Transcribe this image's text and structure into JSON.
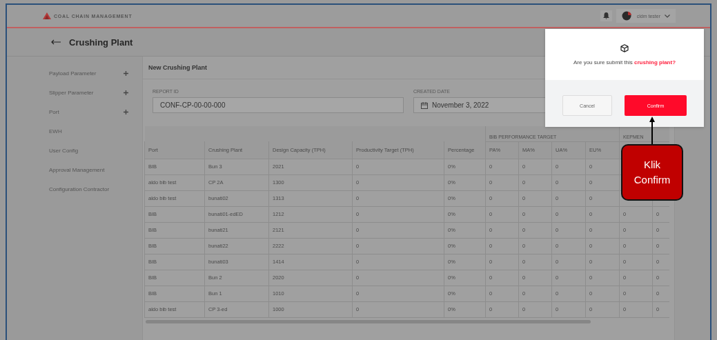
{
  "header": {
    "logo_text": "COAL CHAIN MANAGEMENT",
    "user": {
      "name": "cldm tester"
    }
  },
  "page": {
    "title": "Crushing Plant"
  },
  "sidebar": {
    "items": [
      {
        "label": "Payload Parameter",
        "expandable": true
      },
      {
        "label": "Slipper Parameter",
        "expandable": true
      },
      {
        "label": "Port",
        "expandable": true
      },
      {
        "label": "EWH",
        "expandable": false
      },
      {
        "label": "User Config",
        "expandable": false
      },
      {
        "label": "Approval Management",
        "expandable": false
      },
      {
        "label": "Configuration Contractor",
        "expandable": false
      }
    ]
  },
  "form": {
    "title": "New Crushing Plant",
    "report_id": {
      "label": "REPORT ID",
      "value": "CONF-CP-00-00-000"
    },
    "created_date": {
      "label": "CREATED DATE",
      "value": "November 3, 2022"
    }
  },
  "table": {
    "groups": [
      {
        "label": "BIB PERFORMANCE TARGET"
      },
      {
        "label": "KEPMEN"
      }
    ],
    "columns": [
      "Port",
      "Crushing Plant",
      "Design Capacity (TPH)",
      "Productivity Target (TPH)",
      "Percentage",
      "PA%",
      "MA%",
      "UA%",
      "EU%"
    ],
    "rows": [
      [
        "BIB",
        "Bun 3",
        "2021",
        "0",
        "0%",
        "0",
        "0",
        "0",
        "0"
      ],
      [
        "aldo bib test",
        "CP 2A",
        "1300",
        "0",
        "0%",
        "0",
        "0",
        "0",
        "0"
      ],
      [
        "aldo bib test",
        "bunati02",
        "1313",
        "0",
        "0%",
        "0",
        "0",
        "0",
        "0"
      ],
      [
        "BIB",
        "bunati01-edED",
        "1212",
        "0",
        "0%",
        "0",
        "0",
        "0",
        "0",
        "0",
        "0"
      ],
      [
        "BIB",
        "bunati21",
        "2121",
        "0",
        "0%",
        "0",
        "0",
        "0",
        "0",
        "0",
        "0"
      ],
      [
        "BIB",
        "bunati22",
        "2222",
        "0",
        "0%",
        "0",
        "0",
        "0",
        "0",
        "0",
        "0"
      ],
      [
        "BIB",
        "bunati03",
        "1414",
        "0",
        "0%",
        "0",
        "0",
        "0",
        "0",
        "0",
        "0"
      ],
      [
        "BIB",
        "Bun 2",
        "2020",
        "0",
        "0%",
        "0",
        "0",
        "0",
        "0",
        "0",
        "0"
      ],
      [
        "BIB",
        "Bun 1",
        "1010",
        "0",
        "0%",
        "0",
        "0",
        "0",
        "0",
        "0",
        "0"
      ],
      [
        "aldo bib test",
        "CP 3-ed",
        "1000",
        "0",
        "0%",
        "0",
        "0",
        "0",
        "0",
        "0",
        "0"
      ]
    ]
  },
  "dialog": {
    "message": "Are you sure submit this **crushing plant?**",
    "buttons": [
      {
        "label": "Cancel",
        "kind": "secondary"
      },
      {
        "label": "Confirm",
        "kind": "primary"
      }
    ]
  },
  "callout": {
    "text": "Klik Confirm"
  }
}
